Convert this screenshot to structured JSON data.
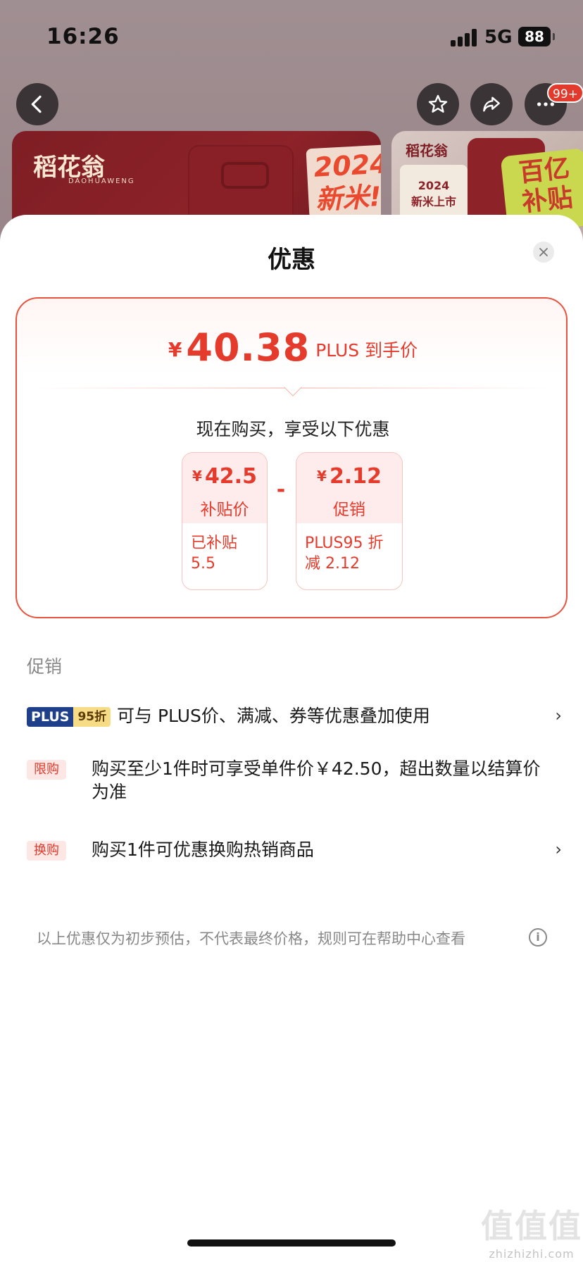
{
  "status": {
    "time": "16:26",
    "network": "5G",
    "battery": "88"
  },
  "nav": {
    "badge": "99+",
    "icons": [
      "back-icon",
      "star-icon",
      "share-icon",
      "more-icon"
    ]
  },
  "banner": {
    "brand": "稻花翁",
    "brand_sub": "DAOHUAWENG",
    "tag_year": "2024",
    "tag_text": "新米!",
    "side_brand": "稻花翁",
    "side_year": "2024",
    "side_text": "新米上市",
    "side_sticker_1": "百亿",
    "side_sticker_2": "补贴"
  },
  "sheet": {
    "title": "优惠",
    "price": {
      "currency": "¥",
      "amount": "40.38",
      "label": "PLUS 到手价"
    },
    "enjoy_text": "现在购买，享受以下优惠",
    "breakdown": [
      {
        "currency": "¥",
        "value": "42.5",
        "name": "补贴价",
        "detail_1": "已补贴",
        "detail_2": "5.5"
      },
      {
        "currency": "¥",
        "value": "2.12",
        "name": "促销",
        "detail_1": "PLUS95 折",
        "detail_2": "减 2.12"
      }
    ],
    "minus": "-",
    "section_label": "促销",
    "promos": [
      {
        "tag_1": "PLUS",
        "tag_2": "95折",
        "text": "可与 PLUS价、满减、券等优惠叠加使用",
        "chevron": "›"
      },
      {
        "tag": "限购",
        "text": "购买至少1件时可享受单件价￥42.50，超出数量以结算价为准"
      },
      {
        "tag": "换购",
        "text": "购买1件可优惠换购热销商品",
        "chevron": "›"
      }
    ],
    "disclaimer": "以上优惠仅为初步预估，不代表最终价格，规则可在帮助中心查看",
    "info_icon": "i"
  },
  "watermark": {
    "logo": "值值值",
    "site": "zhizhizhi.com"
  },
  "colors": {
    "accent": "#e43b2c",
    "plus_blue": "#1f3f8a",
    "plus_gold": "#f6dc86"
  }
}
